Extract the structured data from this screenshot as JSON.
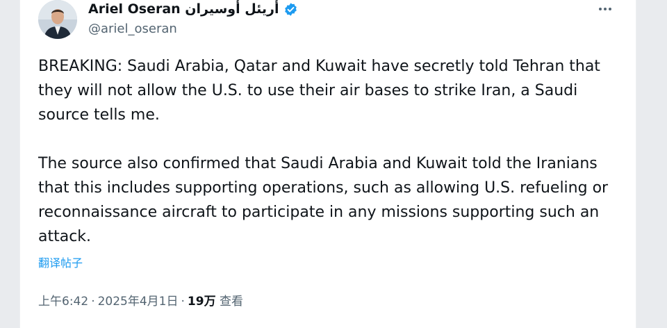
{
  "author": {
    "display_name": "Ariel Oseran أريئل أوسيران",
    "handle": "@ariel_oseran",
    "verified": true
  },
  "post": {
    "paragraphs": [
      "BREAKING: Saudi Arabia, Qatar and Kuwait have secretly told Tehran that they will not allow the U.S. to use their air bases to strike Iran, a Saudi source tells me.",
      "The source also confirmed that Saudi Arabia and Kuwait told the Iranians that this includes supporting operations, such as allowing U.S. refueling or reconnaissance aircraft to participate in any missions supporting such an attack."
    ],
    "translate_label": "翻译帖子"
  },
  "meta": {
    "time": "上午6:42",
    "separator": "·",
    "date": "2025年4月1日",
    "views_count": "19万",
    "views_label": "查看"
  },
  "colors": {
    "text": "#0f1419",
    "secondary": "#536471",
    "link": "#1d9bf0",
    "verified": "#1d9bf0"
  },
  "icons": {
    "verified": "verified-badge-icon",
    "more": "more-horizontal-icon"
  }
}
